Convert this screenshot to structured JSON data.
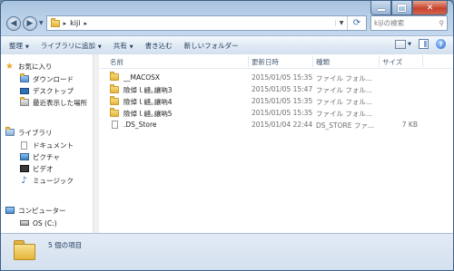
{
  "address": {
    "crumbs": [
      "kiji"
    ],
    "search_placeholder": "kijiの検索"
  },
  "toolbar": {
    "organize": "整理",
    "add_to_library": "ライブラリに追加",
    "share": "共有",
    "burn": "書き込む",
    "new_folder": "新しいフォルダー"
  },
  "nav": {
    "favorites": {
      "label": "お気に入り",
      "items": [
        "ダウンロード",
        "デスクトップ",
        "最近表示した場所"
      ]
    },
    "libraries": {
      "label": "ライブラリ",
      "items": [
        "ドキュメント",
        "ピクチャ",
        "ビデオ",
        "ミュージック"
      ]
    },
    "computer": {
      "label": "コンピューター",
      "items": [
        "OS (C:)"
      ]
    }
  },
  "columns": {
    "name": "名前",
    "modified": "更新日時",
    "type": "種類",
    "size": "サイズ"
  },
  "files": [
    {
      "name": "__MACOSX",
      "modified": "2015/01/05 15:35",
      "type": "ファイル フォル...",
      "size": "",
      "kind": "folder"
    },
    {
      "name": "險倬ｌ縺｡讓吶3",
      "modified": "2015/01/05 15:47",
      "type": "ファイル フォル...",
      "size": "",
      "kind": "folder"
    },
    {
      "name": "險倬ｌ縺｡讓吶4",
      "modified": "2015/01/05 15:35",
      "type": "ファイル フォル...",
      "size": "",
      "kind": "folder"
    },
    {
      "name": "險倬ｌ縺｡讓吶5",
      "modified": "2015/01/05 15:35",
      "type": "ファイル フォル...",
      "size": "",
      "kind": "folder"
    },
    {
      "name": ".DS_Store",
      "modified": "2015/01/04 22:44",
      "type": "DS_STORE ファ...",
      "size": "7 KB",
      "kind": "file"
    }
  ],
  "status": {
    "count": "5 個の項目"
  }
}
